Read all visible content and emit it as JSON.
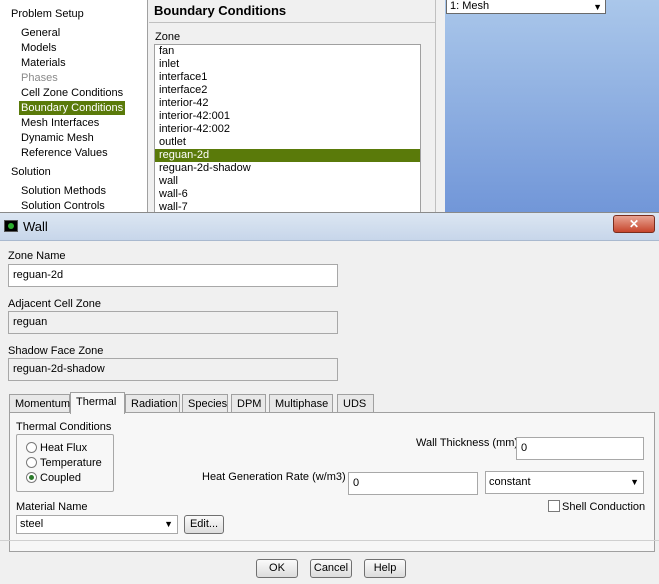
{
  "tree": {
    "sections": [
      {
        "label": "Problem Setup"
      },
      {
        "label": "Solution"
      }
    ],
    "items": [
      {
        "label": "General"
      },
      {
        "label": "Models"
      },
      {
        "label": "Materials"
      },
      {
        "label": "Phases"
      },
      {
        "label": "Cell Zone Conditions"
      },
      {
        "label": "Boundary Conditions"
      },
      {
        "label": "Mesh Interfaces"
      },
      {
        "label": "Dynamic Mesh"
      },
      {
        "label": "Reference Values"
      },
      {
        "label": "Solution Methods"
      },
      {
        "label": "Solution Controls"
      }
    ]
  },
  "boundary_conditions": {
    "title": "Boundary Conditions",
    "zone_label": "Zone",
    "zones": [
      "fan",
      "inlet",
      "interface1",
      "interface2",
      "interior-42",
      "interior-42:001",
      "interior-42:002",
      "outlet",
      "reguan-2d",
      "reguan-2d-shadow",
      "wall",
      "wall-6",
      "wall-7"
    ],
    "selected_zone": "reguan-2d"
  },
  "graphics": {
    "window_select": "1: Mesh"
  },
  "dialog": {
    "title": "Wall",
    "close_label": "✕",
    "zone_name_label": "Zone Name",
    "zone_name_value": "reguan-2d",
    "adjacent_cell_zone_label": "Adjacent Cell Zone",
    "adjacent_cell_zone_value": "reguan",
    "shadow_face_zone_label": "Shadow Face Zone",
    "shadow_face_zone_value": "reguan-2d-shadow",
    "tabs": [
      "Momentum",
      "Thermal",
      "Radiation",
      "Species",
      "DPM",
      "Multiphase",
      "UDS"
    ],
    "active_tab": "Thermal",
    "thermal": {
      "conditions_label": "Thermal Conditions",
      "options": [
        "Heat Flux",
        "Temperature",
        "Coupled"
      ],
      "selected_option": "Coupled",
      "wall_thickness_label": "Wall Thickness (mm)",
      "wall_thickness_value": "0",
      "heat_generation_label": "Heat Generation Rate (w/m3)",
      "heat_generation_value": "0",
      "heat_generation_profile": "constant",
      "material_name_label": "Material Name",
      "material_name_value": "steel",
      "edit_label": "Edit...",
      "shell_conduction_label": "Shell Conduction",
      "shell_conduction_checked": false
    },
    "buttons": {
      "ok": "OK",
      "cancel": "Cancel",
      "help": "Help"
    }
  },
  "colors": {
    "selection": "#5a7a0a",
    "graphics_top": "#aac7ea",
    "graphics_bottom": "#7196d8"
  }
}
